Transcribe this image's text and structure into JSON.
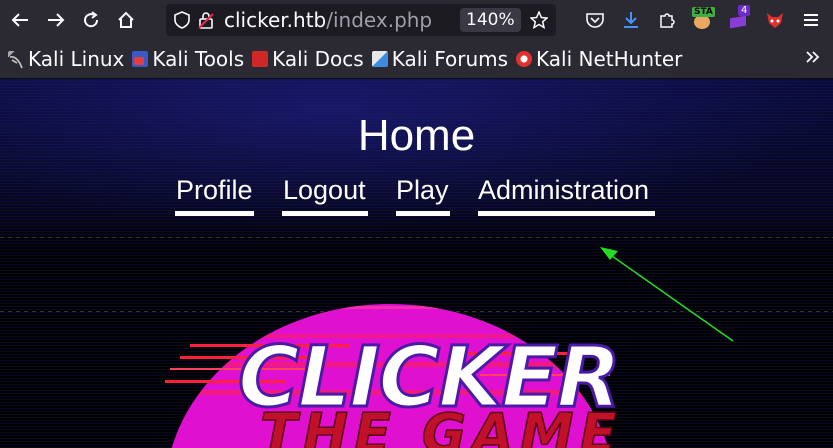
{
  "browser": {
    "url_host": "clicker.htb",
    "url_path": "/index.php",
    "zoom": "140%",
    "extension_badge_1": "STA",
    "extension_badge_2": "4"
  },
  "bookmarks": [
    {
      "label": "Kali Linux",
      "icon": "kali-dragon-icon",
      "color": "#9a9a9a"
    },
    {
      "label": "Kali Tools",
      "icon": "kali-tools-icon",
      "color": "#e04040"
    },
    {
      "label": "Kali Docs",
      "icon": "kali-docs-icon",
      "color": "#d02828"
    },
    {
      "label": "Kali Forums",
      "icon": "kali-forums-icon",
      "color": "#3c8de0"
    },
    {
      "label": "Kali NetHunter",
      "icon": "kali-nethunter-icon",
      "color": "#e03030"
    }
  ],
  "page": {
    "title": "Home",
    "nav": [
      {
        "label": "Profile"
      },
      {
        "label": "Logout"
      },
      {
        "label": "Play"
      },
      {
        "label": "Administration"
      }
    ],
    "logo_text_1": "CLICKER",
    "logo_text_2": "THE GAME"
  },
  "colors": {
    "annotation_arrow": "#22dd22",
    "logo_pink": "#e010d0",
    "logo_red": "#c0102a"
  }
}
